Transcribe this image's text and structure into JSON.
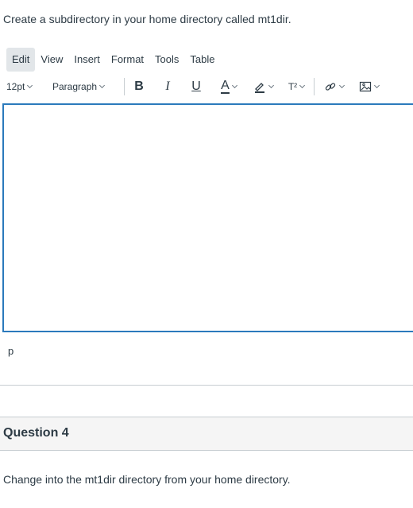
{
  "question3": {
    "prompt": "Create a subdirectory in your home directory called mt1dir."
  },
  "menubar": {
    "items": [
      "Edit",
      "View",
      "Insert",
      "Format",
      "Tools",
      "Table"
    ]
  },
  "toolbar": {
    "font_size": "12pt",
    "block_format": "Paragraph",
    "bold": "B",
    "italic": "I",
    "underline": "U",
    "text_color": "A",
    "superscript": "T²"
  },
  "editor": {
    "content": "",
    "status_path": "p"
  },
  "question4": {
    "title": "Question 4",
    "prompt": "Change into the mt1dir directory from your home directory."
  },
  "colors": {
    "focus_border": "#2b7abc",
    "text": "#2d3b45",
    "menu_active_bg": "#e2e6e9"
  }
}
